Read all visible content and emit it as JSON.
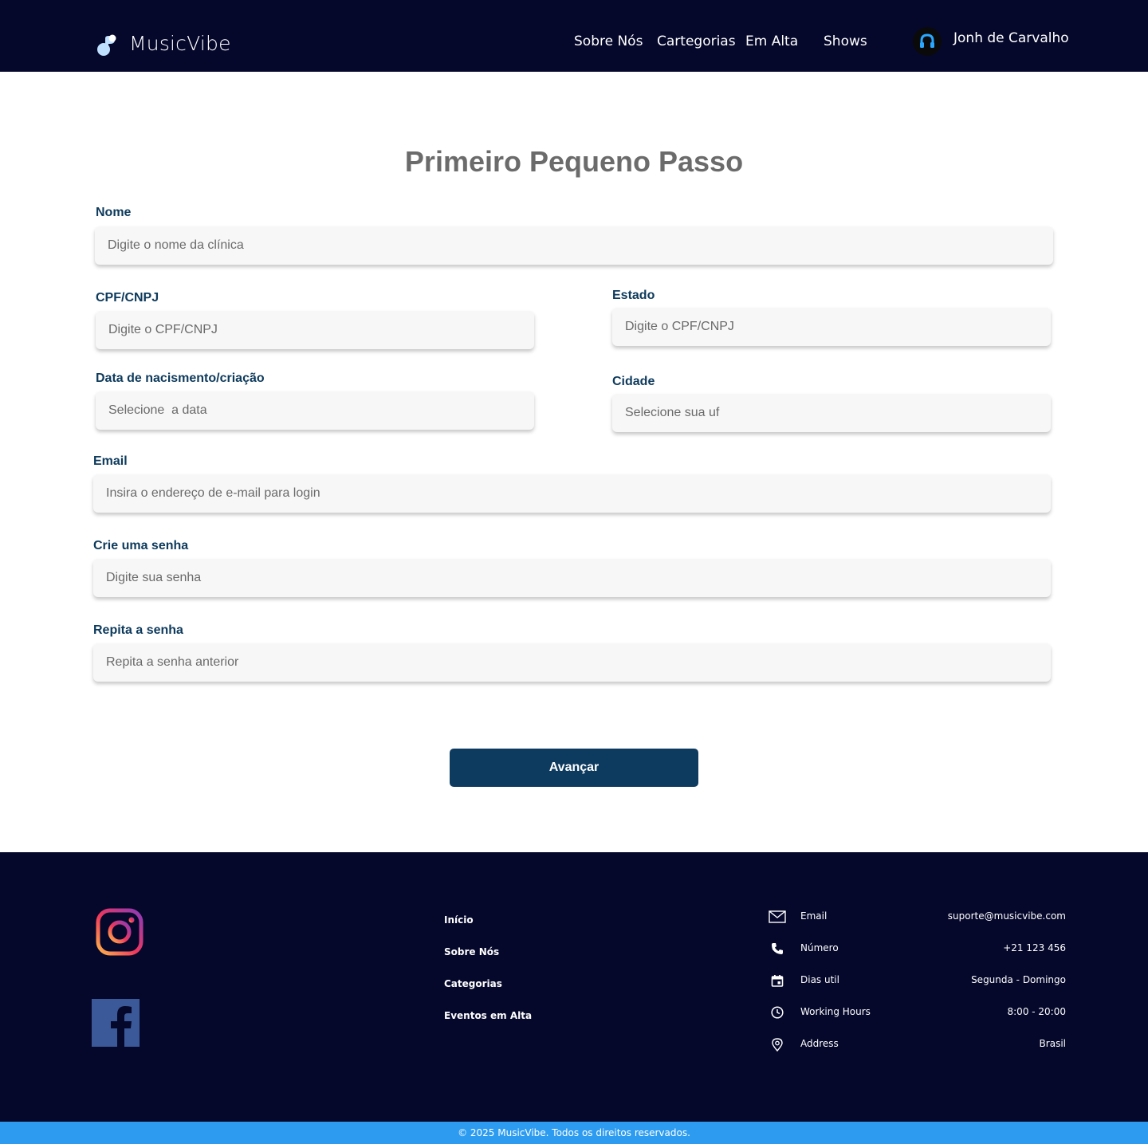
{
  "header": {
    "brand": "MusicVibe",
    "nav": [
      "Sobre Nós",
      "Cartegorias",
      "Em Alta",
      "Shows"
    ],
    "user_name": "Jonh de Carvalho"
  },
  "main": {
    "title": "Primeiro Pequeno Passo",
    "fields": {
      "nome": {
        "label": "Nome",
        "placeholder": "Digite o nome da clínica"
      },
      "cpf": {
        "label": "CPF/CNPJ",
        "placeholder": "Digite o CPF/CNPJ"
      },
      "estado": {
        "label": "Estado",
        "placeholder": "Digite o CPF/CNPJ"
      },
      "data": {
        "label": "Data de nacismento/criação",
        "placeholder": "Selecione  a data"
      },
      "cidade": {
        "label": "Cidade",
        "placeholder": "Selecione sua uf"
      },
      "email": {
        "label": "Email",
        "placeholder": "Insira o endereço de e-mail para login"
      },
      "senha": {
        "label": "Crie uma senha",
        "placeholder": "Digite sua senha"
      },
      "repita": {
        "label": "Repita a senha",
        "placeholder": "Repita a senha anterior"
      }
    },
    "submit_label": "Avançar"
  },
  "footer": {
    "social": [
      "instagram-icon",
      "facebook-icon"
    ],
    "links": [
      "Início",
      "Sobre Nós",
      "Categorias",
      "Eventos em Alta"
    ],
    "contacts": [
      {
        "icon": "mail-icon",
        "label": "Email",
        "value": "suporte@musicvibe.com"
      },
      {
        "icon": "phone-icon",
        "label": "Número",
        "value": "+21 123 456"
      },
      {
        "icon": "calendar-icon",
        "label": "Dias util",
        "value": "Segunda - Domingo"
      },
      {
        "icon": "clock-icon",
        "label": "Working Hours",
        "value": "8:00 - 20:00"
      },
      {
        "icon": "location-pin-icon",
        "label": "Address",
        "value": "Brasil"
      }
    ],
    "copyright": "© 2025 MusicVibe. Todos os direitos reservados."
  },
  "colors": {
    "header_bg": "#05082b",
    "primary_button": "#0d3a5f",
    "label_text": "#0d3a5c",
    "copyright_bar": "#2d9cf0"
  }
}
